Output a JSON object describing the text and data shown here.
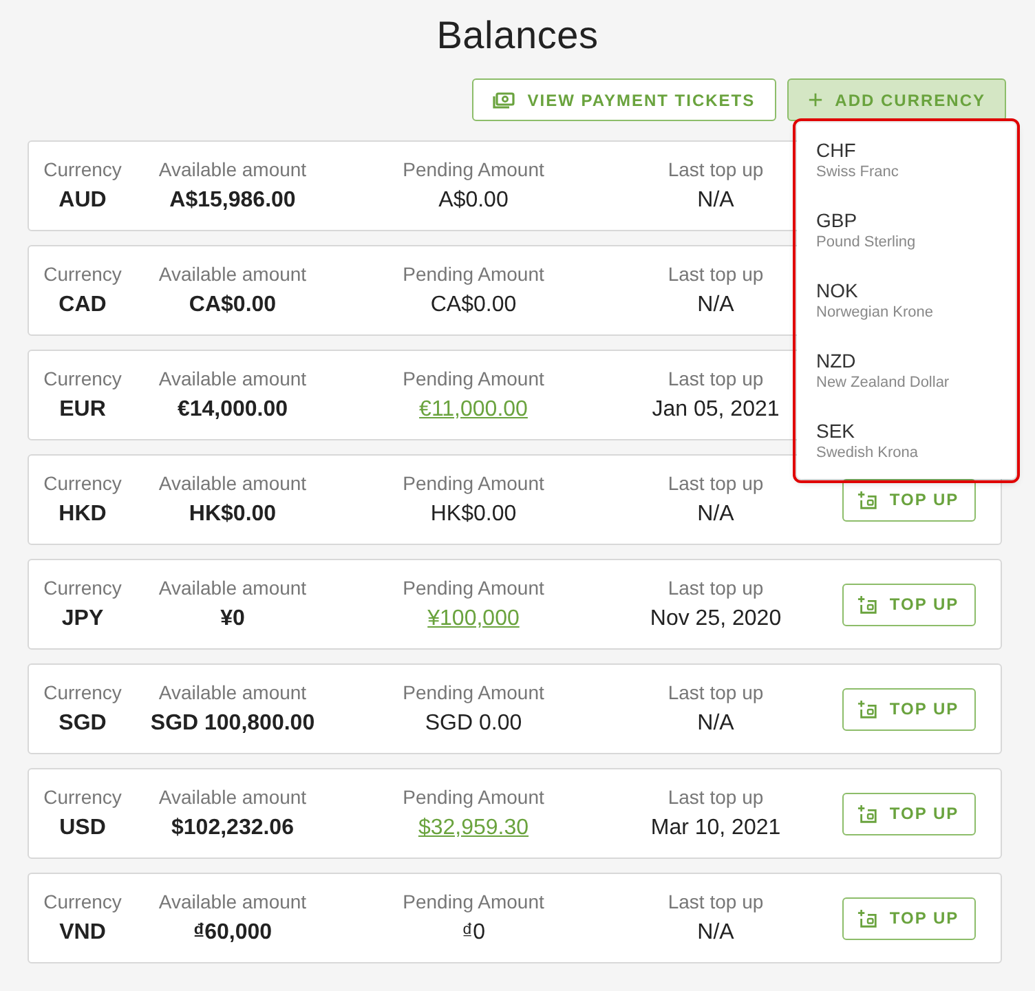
{
  "title": "Balances",
  "toolbar": [
    {
      "label": "VIEW PAYMENT TICKETS",
      "kind": "ticket",
      "selected": false
    },
    {
      "label": "ADD CURRENCY",
      "kind": "add",
      "selected": true
    }
  ],
  "menu": {
    "highlighted": true,
    "items": [
      {
        "code": "CHF",
        "name": "Swiss Franc"
      },
      {
        "code": "GBP",
        "name": "Pound Sterling"
      },
      {
        "code": "NOK",
        "name": "Norwegian Krone"
      },
      {
        "code": "NZD",
        "name": "New Zealand Dollar"
      },
      {
        "code": "SEK",
        "name": "Swedish Krona"
      }
    ]
  },
  "rows": [
    {
      "labels": {
        "currency": "Currency",
        "available": "Available amount",
        "pending": "Pending Amount",
        "last": "Last top up"
      },
      "currency": "AUD",
      "available": "A$15,986.00",
      "pending": "A$0.00",
      "pending_link": false,
      "last_top_up": "N/A"
    },
    {
      "labels": {
        "currency": "Currency",
        "available": "Available amount",
        "pending": "Pending Amount",
        "last": "Last top up"
      },
      "currency": "CAD",
      "available": "CA$0.00",
      "pending": "CA$0.00",
      "pending_link": false,
      "last_top_up": "N/A"
    },
    {
      "labels": {
        "currency": "Currency",
        "available": "Available amount",
        "pending": "Pending Amount",
        "last": "Last top up"
      },
      "currency": "EUR",
      "available": "€14,000.00",
      "pending": "€11,000.00",
      "pending_link": true,
      "last_top_up": "Jan 05, 2021"
    },
    {
      "labels": {
        "currency": "Currency",
        "available": "Available amount",
        "pending": "Pending Amount",
        "last": "Last top up"
      },
      "currency": "HKD",
      "available": "HK$0.00",
      "pending": "HK$0.00",
      "pending_link": false,
      "last_top_up": "N/A",
      "top_up": "TOP UP"
    },
    {
      "labels": {
        "currency": "Currency",
        "available": "Available amount",
        "pending": "Pending Amount",
        "last": "Last top up"
      },
      "currency": "JPY",
      "available": "¥0",
      "pending": "¥100,000",
      "pending_link": true,
      "last_top_up": "Nov 25, 2020",
      "top_up": "TOP UP"
    },
    {
      "labels": {
        "currency": "Currency",
        "available": "Available amount",
        "pending": "Pending Amount",
        "last": "Last top up"
      },
      "currency": "SGD",
      "available": "SGD 100,800.00",
      "pending": "SGD 0.00",
      "pending_link": false,
      "last_top_up": "N/A",
      "top_up": "TOP UP"
    },
    {
      "labels": {
        "currency": "Currency",
        "available": "Available amount",
        "pending": "Pending Amount",
        "last": "Last top up"
      },
      "currency": "USD",
      "available": "$102,232.06",
      "pending": "$32,959.30",
      "pending_link": true,
      "last_top_up": "Mar 10, 2021",
      "top_up": "TOP UP"
    },
    {
      "labels": {
        "currency": "Currency",
        "available": "Available amount",
        "pending": "Pending Amount",
        "last": "Last top up"
      },
      "currency": "VND",
      "available": "₫60,000",
      "pending": "₫0",
      "pending_link": false,
      "last_top_up": "N/A",
      "top_up": "TOP UP"
    }
  ]
}
